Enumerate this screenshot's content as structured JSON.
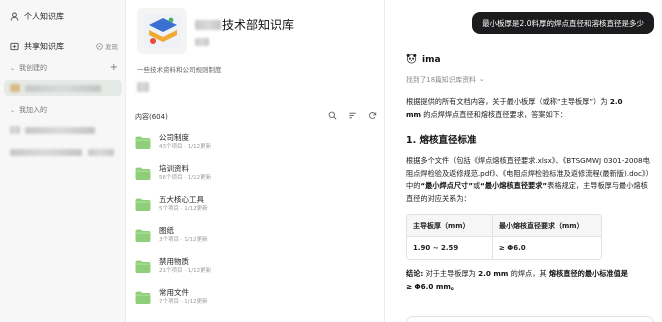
{
  "sidebar": {
    "personal_label": "个人知识库",
    "shared_label": "共享知识库",
    "invite_label": "发现",
    "created_label": "我创建的",
    "joined_label": "我加入的"
  },
  "kb": {
    "title_suffix": "技术部知识库",
    "description": "一些技术资料和公司规则制度",
    "content_count_label": "内容(604)",
    "folders": [
      {
        "name": "公司制度",
        "meta": "43个项目 · 1/12更新"
      },
      {
        "name": "培训资料",
        "meta": "56个项目 · 1/12更新"
      },
      {
        "name": "五大核心工具",
        "meta": "5个项目 · 1/12更新"
      },
      {
        "name": "图纸",
        "meta": "3个项目 · 1/12更新"
      },
      {
        "name": "禁用物质",
        "meta": "21个项目 · 1/12更新"
      },
      {
        "name": "常用文件",
        "meta": "7个项目 · 1/12更新"
      }
    ]
  },
  "chat": {
    "user_question": "最小板厚是2.0料厚的焊点直径和溶核直径是多少",
    "bot_name": "ima",
    "found_label": "找到了18篇知识库资料",
    "intro_1": "根据提供的所有文档内容，关于最小板厚（或称“主导板厚”）为 ",
    "intro_bold_1": "2.0",
    "intro_bold_2": "mm",
    "intro_2": " 的点焊焊点直径和熔核直径要求，答案如下：",
    "section_title": "1. 熔核直径标准",
    "body_1": "根据多个文件（包括《焊点熔核直径要求.xlsx》、《BTSGMWJ 0301-2008电阻点焊检验及返修规范.pdf》、《电阻点焊检验标准及返修流程(最新版).doc》）中的",
    "body_bold_1": "“最小焊点尺寸”",
    "body_mid": "或",
    "body_bold_2": "“最小熔核直径要求”",
    "body_2": "表格规定，主导板厚与最小熔核直径的对应关系为：",
    "table": {
      "headers": [
        "主导板厚（mm）",
        "最小熔核直径要求（mm）"
      ],
      "rows": [
        [
          "1.90 ~ 2.59",
          "≥ Φ6.0"
        ]
      ]
    },
    "conclusion_label": "结论:",
    "conclusion_1": " 对于主导板厚为 ",
    "conclusion_bold_1": "2.0 mm",
    "conclusion_2": " 的焊点，其 ",
    "conclusion_bold_2": "熔核直径的最小标准值是",
    "conclusion_3": "≥ Φ6.0 mm。"
  },
  "colors": {
    "folder_green": "#8fcf7a",
    "bubble_dark": "#1c1c1e",
    "selected_bg": "#e6eae6"
  },
  "icons": {
    "personal": "person-icon",
    "shared": "shared-kb-icon",
    "search": "search-icon",
    "sort": "sort-icon",
    "refresh": "refresh-icon",
    "bot": "panda-avatar-icon"
  }
}
